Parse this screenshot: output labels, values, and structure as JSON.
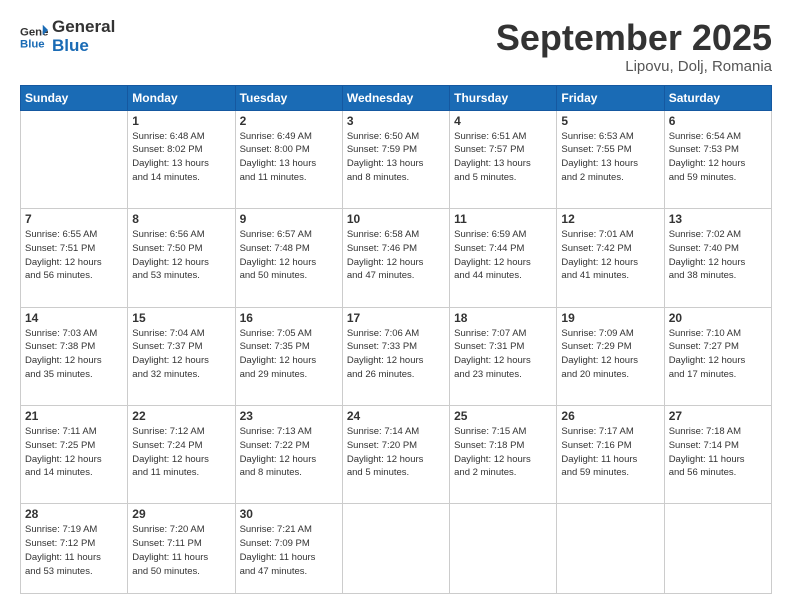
{
  "header": {
    "logo_line1": "General",
    "logo_line2": "Blue",
    "month": "September 2025",
    "location": "Lipovu, Dolj, Romania"
  },
  "weekdays": [
    "Sunday",
    "Monday",
    "Tuesday",
    "Wednesday",
    "Thursday",
    "Friday",
    "Saturday"
  ],
  "weeks": [
    [
      {
        "day": "",
        "info": ""
      },
      {
        "day": "1",
        "info": "Sunrise: 6:48 AM\nSunset: 8:02 PM\nDaylight: 13 hours\nand 14 minutes."
      },
      {
        "day": "2",
        "info": "Sunrise: 6:49 AM\nSunset: 8:00 PM\nDaylight: 13 hours\nand 11 minutes."
      },
      {
        "day": "3",
        "info": "Sunrise: 6:50 AM\nSunset: 7:59 PM\nDaylight: 13 hours\nand 8 minutes."
      },
      {
        "day": "4",
        "info": "Sunrise: 6:51 AM\nSunset: 7:57 PM\nDaylight: 13 hours\nand 5 minutes."
      },
      {
        "day": "5",
        "info": "Sunrise: 6:53 AM\nSunset: 7:55 PM\nDaylight: 13 hours\nand 2 minutes."
      },
      {
        "day": "6",
        "info": "Sunrise: 6:54 AM\nSunset: 7:53 PM\nDaylight: 12 hours\nand 59 minutes."
      }
    ],
    [
      {
        "day": "7",
        "info": "Sunrise: 6:55 AM\nSunset: 7:51 PM\nDaylight: 12 hours\nand 56 minutes."
      },
      {
        "day": "8",
        "info": "Sunrise: 6:56 AM\nSunset: 7:50 PM\nDaylight: 12 hours\nand 53 minutes."
      },
      {
        "day": "9",
        "info": "Sunrise: 6:57 AM\nSunset: 7:48 PM\nDaylight: 12 hours\nand 50 minutes."
      },
      {
        "day": "10",
        "info": "Sunrise: 6:58 AM\nSunset: 7:46 PM\nDaylight: 12 hours\nand 47 minutes."
      },
      {
        "day": "11",
        "info": "Sunrise: 6:59 AM\nSunset: 7:44 PM\nDaylight: 12 hours\nand 44 minutes."
      },
      {
        "day": "12",
        "info": "Sunrise: 7:01 AM\nSunset: 7:42 PM\nDaylight: 12 hours\nand 41 minutes."
      },
      {
        "day": "13",
        "info": "Sunrise: 7:02 AM\nSunset: 7:40 PM\nDaylight: 12 hours\nand 38 minutes."
      }
    ],
    [
      {
        "day": "14",
        "info": "Sunrise: 7:03 AM\nSunset: 7:38 PM\nDaylight: 12 hours\nand 35 minutes."
      },
      {
        "day": "15",
        "info": "Sunrise: 7:04 AM\nSunset: 7:37 PM\nDaylight: 12 hours\nand 32 minutes."
      },
      {
        "day": "16",
        "info": "Sunrise: 7:05 AM\nSunset: 7:35 PM\nDaylight: 12 hours\nand 29 minutes."
      },
      {
        "day": "17",
        "info": "Sunrise: 7:06 AM\nSunset: 7:33 PM\nDaylight: 12 hours\nand 26 minutes."
      },
      {
        "day": "18",
        "info": "Sunrise: 7:07 AM\nSunset: 7:31 PM\nDaylight: 12 hours\nand 23 minutes."
      },
      {
        "day": "19",
        "info": "Sunrise: 7:09 AM\nSunset: 7:29 PM\nDaylight: 12 hours\nand 20 minutes."
      },
      {
        "day": "20",
        "info": "Sunrise: 7:10 AM\nSunset: 7:27 PM\nDaylight: 12 hours\nand 17 minutes."
      }
    ],
    [
      {
        "day": "21",
        "info": "Sunrise: 7:11 AM\nSunset: 7:25 PM\nDaylight: 12 hours\nand 14 minutes."
      },
      {
        "day": "22",
        "info": "Sunrise: 7:12 AM\nSunset: 7:24 PM\nDaylight: 12 hours\nand 11 minutes."
      },
      {
        "day": "23",
        "info": "Sunrise: 7:13 AM\nSunset: 7:22 PM\nDaylight: 12 hours\nand 8 minutes."
      },
      {
        "day": "24",
        "info": "Sunrise: 7:14 AM\nSunset: 7:20 PM\nDaylight: 12 hours\nand 5 minutes."
      },
      {
        "day": "25",
        "info": "Sunrise: 7:15 AM\nSunset: 7:18 PM\nDaylight: 12 hours\nand 2 minutes."
      },
      {
        "day": "26",
        "info": "Sunrise: 7:17 AM\nSunset: 7:16 PM\nDaylight: 11 hours\nand 59 minutes."
      },
      {
        "day": "27",
        "info": "Sunrise: 7:18 AM\nSunset: 7:14 PM\nDaylight: 11 hours\nand 56 minutes."
      }
    ],
    [
      {
        "day": "28",
        "info": "Sunrise: 7:19 AM\nSunset: 7:12 PM\nDaylight: 11 hours\nand 53 minutes."
      },
      {
        "day": "29",
        "info": "Sunrise: 7:20 AM\nSunset: 7:11 PM\nDaylight: 11 hours\nand 50 minutes."
      },
      {
        "day": "30",
        "info": "Sunrise: 7:21 AM\nSunset: 7:09 PM\nDaylight: 11 hours\nand 47 minutes."
      },
      {
        "day": "",
        "info": ""
      },
      {
        "day": "",
        "info": ""
      },
      {
        "day": "",
        "info": ""
      },
      {
        "day": "",
        "info": ""
      }
    ]
  ]
}
